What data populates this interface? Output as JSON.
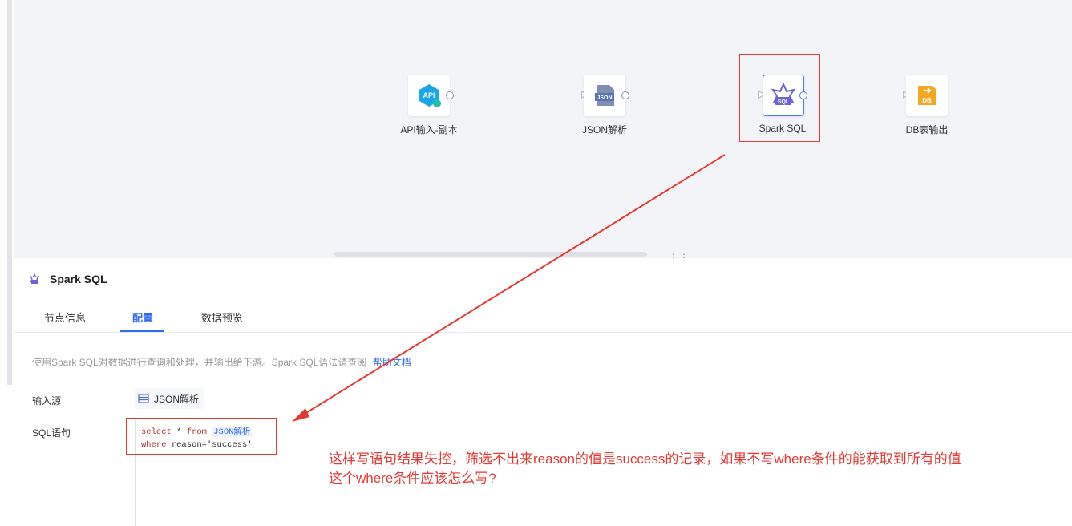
{
  "flow": {
    "nodes": [
      {
        "label": "API输入-副本",
        "icon": "api-icon"
      },
      {
        "label": "JSON解析",
        "icon": "json-file-icon"
      },
      {
        "label": "Spark SQL",
        "icon": "sql-star-icon"
      },
      {
        "label": "DB表输出",
        "icon": "db-output-icon"
      }
    ],
    "api_badge": "API",
    "json_badge": "JSON",
    "sql_badge": "SQL",
    "db_badge": "DB"
  },
  "panel": {
    "title": "Spark SQL",
    "tabs": [
      {
        "label": "节点信息"
      },
      {
        "label": "配置"
      },
      {
        "label": "数据预览"
      }
    ],
    "active_tab": "配置",
    "description": "使用Spark SQL对数据进行查询和处理，并输出给下游。Spark SQL语法请查阅",
    "help_link": "帮助文档",
    "input_source_label": "输入源",
    "input_source_value": "JSON解析",
    "sql_label": "SQL语句",
    "sql": {
      "line1_kw1": "select",
      "line1_star": " * ",
      "line1_kw2": "from",
      "line1_table": "JSON解析",
      "line2_kw": "where",
      "line2_text": " reason=",
      "line2_str": "'success'"
    }
  },
  "annotation": {
    "line1": "这样写语句结果失控，筛选不出来reason的值是success的记录，如果不写where条件的能获取到所有的值",
    "line2": "这个where条件应该怎么写?"
  },
  "colors": {
    "accent": "#2f6bf0",
    "annotation_red": "#e53935",
    "canvas_bg": "#f3f4f8"
  }
}
